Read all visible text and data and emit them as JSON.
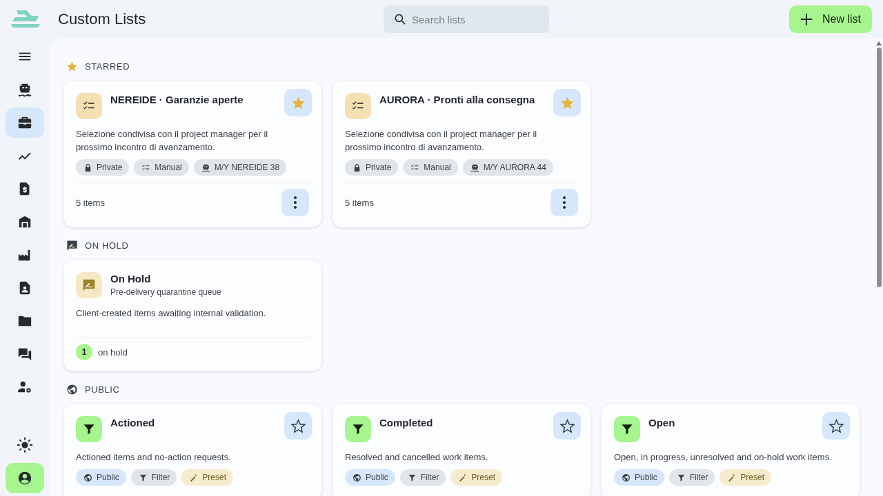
{
  "header": {
    "title": "Custom Lists",
    "search": {
      "placeholder": "Search lists"
    },
    "new_button": "New list"
  },
  "sidebar": {
    "items": [
      {
        "selected": false
      },
      {
        "selected": false
      },
      {
        "selected": true
      },
      {
        "selected": false
      },
      {
        "selected": false
      },
      {
        "selected": false
      },
      {
        "selected": false
      },
      {
        "selected": false
      },
      {
        "selected": false
      },
      {
        "selected": false
      },
      {
        "selected": false
      }
    ],
    "bottom": [
      {
        "selected": false
      },
      {
        "selected": true
      }
    ]
  },
  "sections": [
    {
      "kind": "starred",
      "title": "STARRED",
      "cards": [
        {
          "kind": "list",
          "title": "NEREIDE · Garanzie aperte",
          "starred": true,
          "description": "Selezione condivisa con il project manager per il prossimo incontro di avanzamento.",
          "tags": [
            {
              "kind": "private",
              "label": "Private"
            },
            {
              "kind": "manual",
              "label": "Manual"
            },
            {
              "kind": "vessel",
              "label": "M/Y NEREIDE 38"
            }
          ],
          "count": "5 items"
        },
        {
          "kind": "list",
          "title": "AURORA · Pronti alla consegna",
          "starred": true,
          "description": "Selezione condivisa con il project manager per il prossimo incontro di avanzamento.",
          "tags": [
            {
              "kind": "private",
              "label": "Private"
            },
            {
              "kind": "manual",
              "label": "Manual"
            },
            {
              "kind": "vessel",
              "label": "M/Y AURORA 44"
            }
          ],
          "count": "5 items"
        }
      ]
    },
    {
      "kind": "hold",
      "title": "ON HOLD",
      "cards": [
        {
          "kind": "hold",
          "title": "On Hold",
          "subtitle": "Pre-delivery quarantine queue",
          "description": "Client-created items awaiting internal validation.",
          "badge": "1",
          "count": "on hold"
        }
      ]
    },
    {
      "kind": "public",
      "title": "PUBLIC",
      "cards": [
        {
          "kind": "filter",
          "title": "Actioned",
          "starred": false,
          "description": "Actioned items and no-action requests.",
          "tags": [
            {
              "kind": "public",
              "label": "Public"
            },
            {
              "kind": "filter",
              "label": "Filter"
            },
            {
              "kind": "preset",
              "label": "Preset"
            }
          ]
        },
        {
          "kind": "filter",
          "title": "Completed",
          "starred": false,
          "description": "Resolved and cancelled work items.",
          "tags": [
            {
              "kind": "public",
              "label": "Public"
            },
            {
              "kind": "filter",
              "label": "Filter"
            },
            {
              "kind": "preset",
              "label": "Preset"
            }
          ]
        },
        {
          "kind": "filter",
          "title": "Open",
          "starred": false,
          "description": "Open, in progress, unresolved and on-hold work items.",
          "tags": [
            {
              "kind": "public",
              "label": "Public"
            },
            {
              "kind": "filter",
              "label": "Filter"
            },
            {
              "kind": "preset",
              "label": "Preset"
            }
          ]
        }
      ]
    }
  ]
}
